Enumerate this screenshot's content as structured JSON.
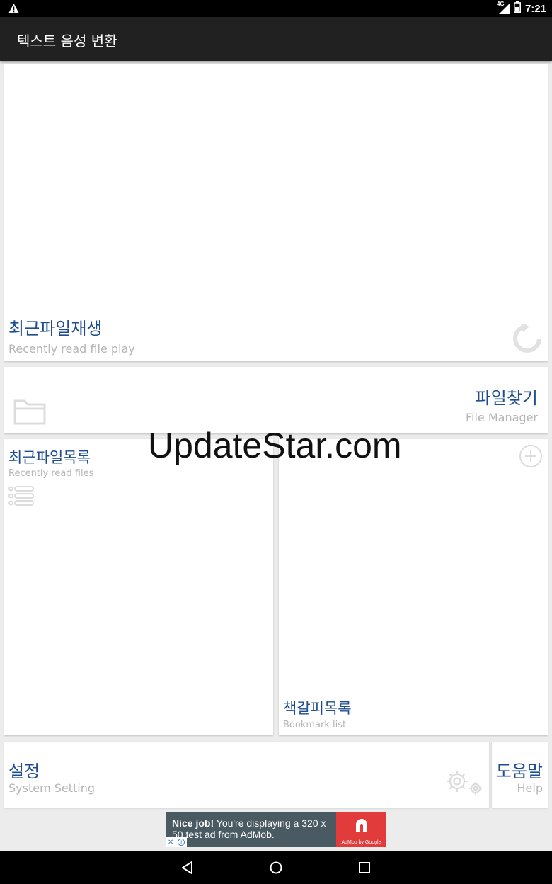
{
  "status_bar": {
    "time": "7:21",
    "network": "4G"
  },
  "app_bar": {
    "title": "텍스트 음성 변환"
  },
  "recent_play": {
    "title": "최근파일재생",
    "subtitle": "Recently read file play",
    "icon": "refresh-icon"
  },
  "file_manager": {
    "title": "파일찾기",
    "subtitle": "File Manager",
    "icon": "folder-icon"
  },
  "recent_files": {
    "title": "최근파일목록",
    "subtitle": "Recently read files",
    "icon": "list-icon"
  },
  "bookmarks": {
    "title": "책갈피목록",
    "subtitle": "Bookmark list",
    "icon": "add-circle-icon"
  },
  "settings": {
    "title": "설정",
    "subtitle": "System Setting",
    "icon": "gear-icon"
  },
  "help": {
    "title": "도움말",
    "subtitle": "Help"
  },
  "watermark": "UpdateStar.com",
  "ad": {
    "bold": "Nice job!",
    "text": " You're displaying a 320 x 50 test ad from AdMob.",
    "brand": "AdMob by Google",
    "close": "✕",
    "info": "i"
  },
  "colors": {
    "title_blue": "#1d4d8f",
    "subtitle_gray": "#b5b5b5",
    "appbar": "#212121",
    "background": "#ececec"
  }
}
